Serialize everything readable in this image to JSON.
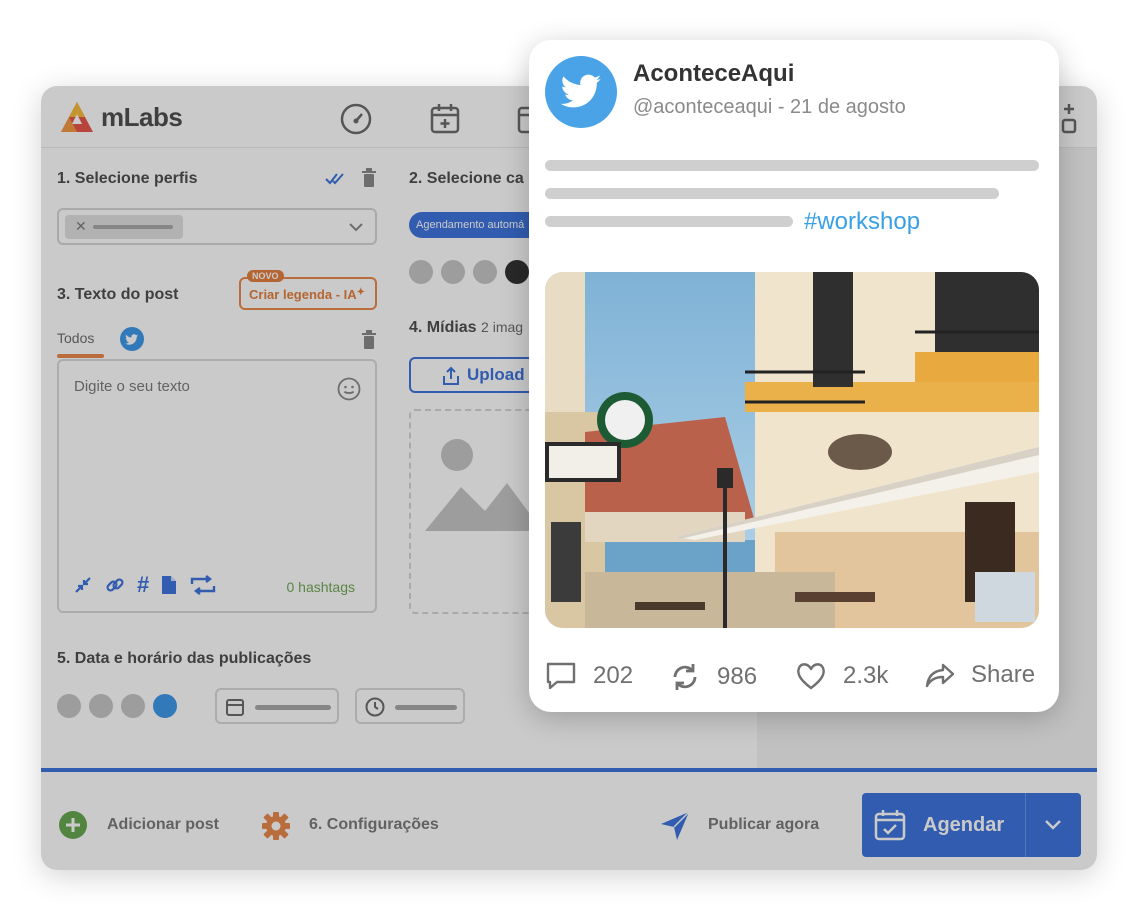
{
  "app": {
    "logo_text": "mLabs",
    "sections": {
      "s1": "1. Selecione perfis",
      "s2": "2. Selecione ca",
      "s3": "3. Texto do post",
      "s4_title": "4. Mídias",
      "s4_sub": "2 imag",
      "s5": "5. Data e horário das publicações"
    },
    "auto_badge": "Agendamento automá",
    "ia_button": "Criar legenda - IA",
    "novo_badge": "NOVO",
    "tab_todos": "Todos",
    "text_placeholder": "Digite o seu texto",
    "hashtags_count": "0 hashtags",
    "upload_label": "Upload",
    "footer": {
      "add_post": "Adicionar post",
      "settings": "6. Configurações",
      "publish_now": "Publicar agora",
      "schedule": "Agendar"
    },
    "colors": {
      "brand_blue": "#1e5ed8",
      "orange": "#e8772e",
      "green": "#5a9a3d"
    }
  },
  "tweet": {
    "name": "AconteceAqui",
    "handle": "@aconteceaqui - 21 de agosto",
    "hashtag": "#workshop",
    "replies": "202",
    "retweets": "986",
    "likes": "2.3k",
    "share": "Share",
    "colors": {
      "twitter_blue": "#4aa3e6",
      "hashtag": "#3aa0e4"
    }
  }
}
